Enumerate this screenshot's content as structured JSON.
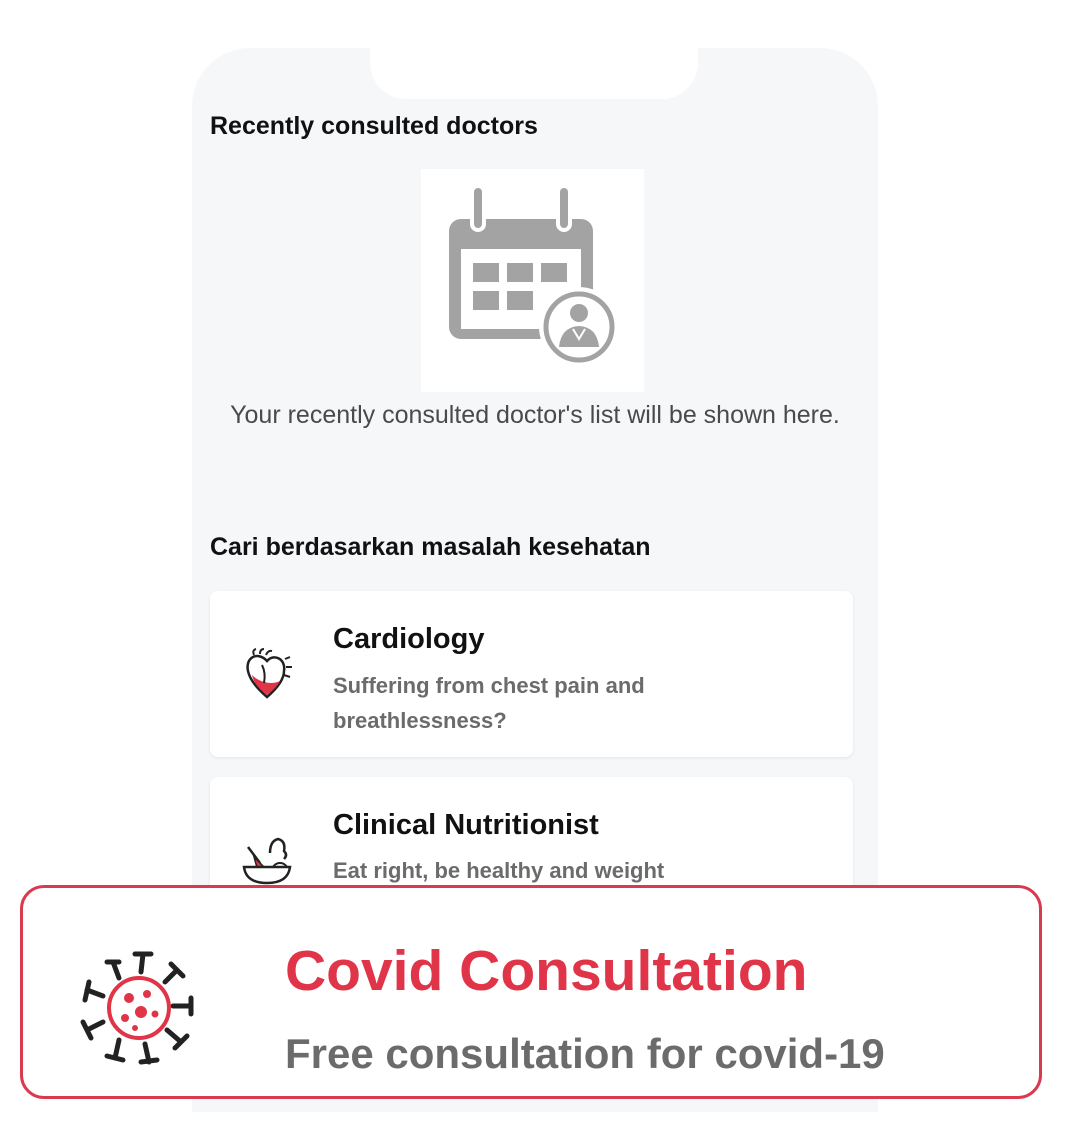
{
  "recent": {
    "title": "Recently consulted doctors",
    "empty_message": "Your recently consulted doctor's list will be shown here.",
    "illustration_icon": "calendar-doctor-icon"
  },
  "search": {
    "title": "Cari berdasarkan masalah kesehatan",
    "cards": [
      {
        "title": "Cardiology",
        "subtitle": "Suffering from chest pain and breathlessness?",
        "icon": "heart-icon"
      },
      {
        "title": "Clinical Nutritionist",
        "subtitle": "Eat right, be healthy and weight",
        "icon": "salad-bowl-icon"
      }
    ]
  },
  "banner": {
    "title": "Covid Consultation",
    "subtitle": "Free consultation for covid-19",
    "icon": "virus-icon"
  },
  "colors": {
    "accent": "#e03549",
    "background": "#f6f7f9",
    "icon_gray": "#a3a3a3"
  }
}
